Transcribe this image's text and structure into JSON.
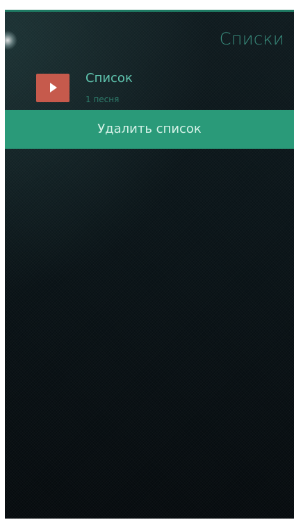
{
  "page": {
    "title": "Списки"
  },
  "playlists": [
    {
      "title": "Список",
      "subtitle": "1 песня",
      "icon": "play-icon"
    }
  ],
  "context_menu": {
    "items": [
      {
        "label": "Удалить список"
      }
    ]
  },
  "colors": {
    "accent": "#2a9a79",
    "title": "#3a8f7f",
    "thumb": "#c65a4c",
    "background": "#0a1418"
  }
}
